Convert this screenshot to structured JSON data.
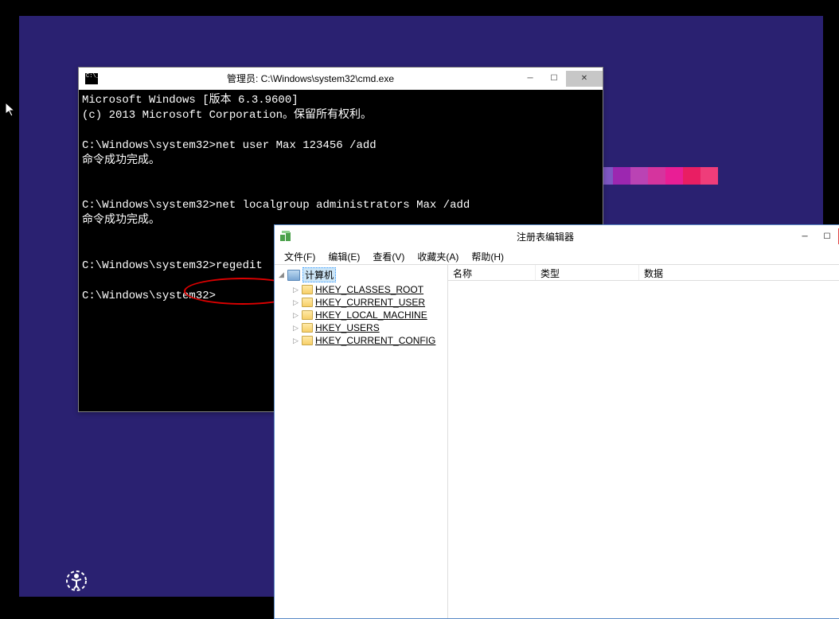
{
  "cmd": {
    "title": "管理员: C:\\Windows\\system32\\cmd.exe",
    "lines": {
      "l0": "Microsoft Windows [版本 6.3.9600]",
      "l1": "(c) 2013 Microsoft Corporation。保留所有权利。",
      "l2": "",
      "l3": "C:\\Windows\\system32>net user Max 123456 /add",
      "l4": "命令成功完成。",
      "l5": "",
      "l6": "",
      "l7": "C:\\Windows\\system32>net localgroup administrators Max /add",
      "l8": "命令成功完成。",
      "l9": "",
      "l10": "",
      "l11": "C:\\Windows\\system32>regedit",
      "l12": "",
      "l13": "C:\\Windows\\system32>"
    }
  },
  "regedit": {
    "title": "注册表编辑器",
    "menu": {
      "file": "文件(F)",
      "edit": "编辑(E)",
      "view": "查看(V)",
      "fav": "收藏夹(A)",
      "help": "帮助(H)"
    },
    "tree": {
      "root": "计算机",
      "k0": "HKEY_CLASSES_ROOT",
      "k1": "HKEY_CURRENT_USER",
      "k2": "HKEY_LOCAL_MACHINE",
      "k3": "HKEY_USERS",
      "k4": "HKEY_CURRENT_CONFIG"
    },
    "cols": {
      "name": "名称",
      "type": "类型",
      "data": "数据"
    }
  },
  "colors": {
    "strip": [
      "#7e57c2",
      "#9c27b0",
      "#ba43b4",
      "#d5349e",
      "#e91e95",
      "#e91e63",
      "#ef3d7a",
      "#f5488a"
    ]
  }
}
